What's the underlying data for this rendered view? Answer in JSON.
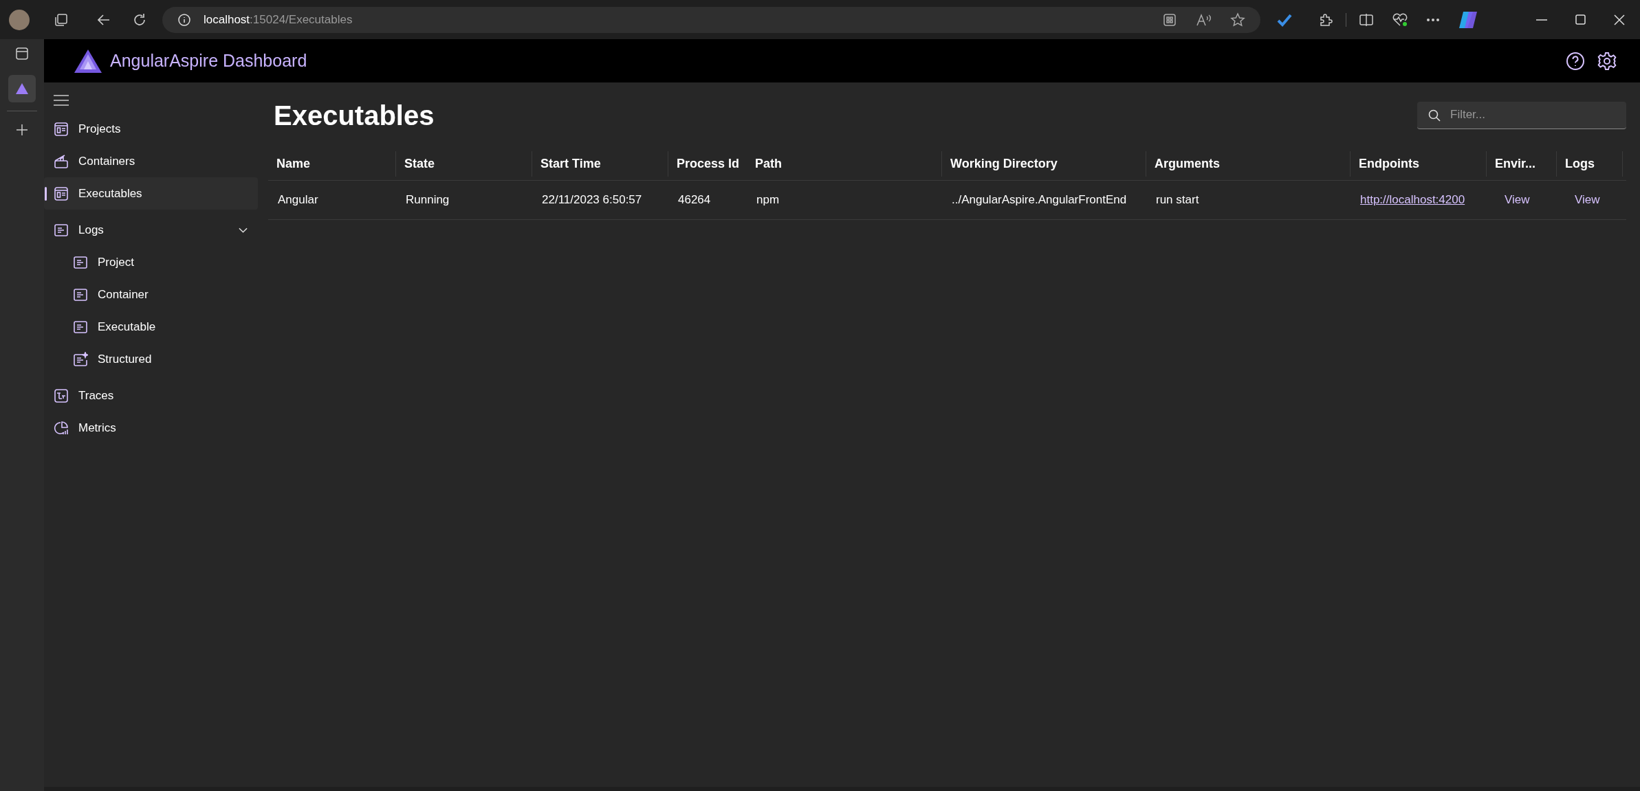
{
  "browser": {
    "url_host": "localhost",
    "url_rest": ":15024/Executables"
  },
  "app": {
    "title": "AngularAspire Dashboard"
  },
  "sidebar": {
    "items": [
      {
        "label": "Projects",
        "kind": "link",
        "selected": false
      },
      {
        "label": "Containers",
        "kind": "link",
        "selected": false
      },
      {
        "label": "Executables",
        "kind": "link",
        "selected": true
      },
      {
        "label": "Logs",
        "kind": "group",
        "selected": false,
        "expanded": true,
        "children": [
          {
            "label": "Project",
            "selected": false
          },
          {
            "label": "Container",
            "selected": false
          },
          {
            "label": "Executable",
            "selected": false
          },
          {
            "label": "Structured",
            "selected": false
          }
        ]
      },
      {
        "label": "Traces",
        "kind": "link",
        "selected": false
      },
      {
        "label": "Metrics",
        "kind": "link",
        "selected": false
      }
    ]
  },
  "page": {
    "title": "Executables",
    "filter": {
      "placeholder": "Filter..."
    }
  },
  "table": {
    "columns": [
      "Name",
      "State",
      "Start Time",
      "Process Id",
      "Path",
      "Working Directory",
      "Arguments",
      "Endpoints",
      "Envir...",
      "Logs"
    ],
    "rows": [
      {
        "cells": [
          {
            "kind": "text",
            "text": "Angular"
          },
          {
            "kind": "text",
            "text": "Running"
          },
          {
            "kind": "text",
            "text": "22/11/2023 6:50:57"
          },
          {
            "kind": "text",
            "text": "46264"
          },
          {
            "kind": "text",
            "text": "npm"
          },
          {
            "kind": "text",
            "text": "../AngularAspire.AngularFrontEnd"
          },
          {
            "kind": "text",
            "text": "run start"
          },
          {
            "kind": "url",
            "text": "http://localhost:4200"
          },
          {
            "kind": "action",
            "text": "View"
          },
          {
            "kind": "action",
            "text": "View"
          }
        ]
      }
    ]
  }
}
